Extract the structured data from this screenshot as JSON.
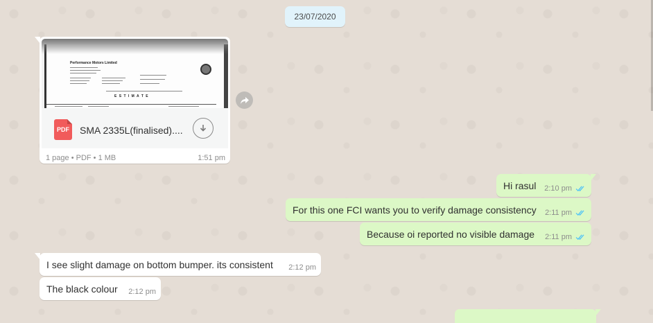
{
  "date_label": "23/07/2020",
  "document": {
    "filename": "SMA 2335L(finalised)....",
    "meta": "1 page • PDF • 1 MB",
    "time": "1:51 pm",
    "icon_label": "PDF",
    "preview": {
      "company": "Performance Motors Limited",
      "heading": "E S T I M A T E"
    }
  },
  "messages": [
    {
      "direction": "out",
      "text": "Hi rasul",
      "time": "2:10 pm",
      "status": "read"
    },
    {
      "direction": "out",
      "text": "For this one FCI wants you to verify damage consistency",
      "time": "2:11 pm",
      "status": "read"
    },
    {
      "direction": "out",
      "text": "Because oi reported no visible damage",
      "time": "2:11 pm",
      "status": "read"
    },
    {
      "direction": "in",
      "text": "I see slight damage on bottom bumper. its consistent",
      "time": "2:12 pm"
    },
    {
      "direction": "in",
      "text": "The black colour",
      "time": "2:12 pm"
    }
  ],
  "icons": {
    "download": "download-icon",
    "forward": "forward-icon",
    "pdf": "pdf-file-icon",
    "read_receipt": "double-check-icon"
  },
  "colors": {
    "chat_background": "#e5ddd5",
    "outgoing_bubble": "#dcf8c6",
    "incoming_bubble": "#ffffff",
    "date_pill": "#e1f3fb",
    "read_tick": "#4fc3f7",
    "pdf_red": "#f15b5b"
  }
}
